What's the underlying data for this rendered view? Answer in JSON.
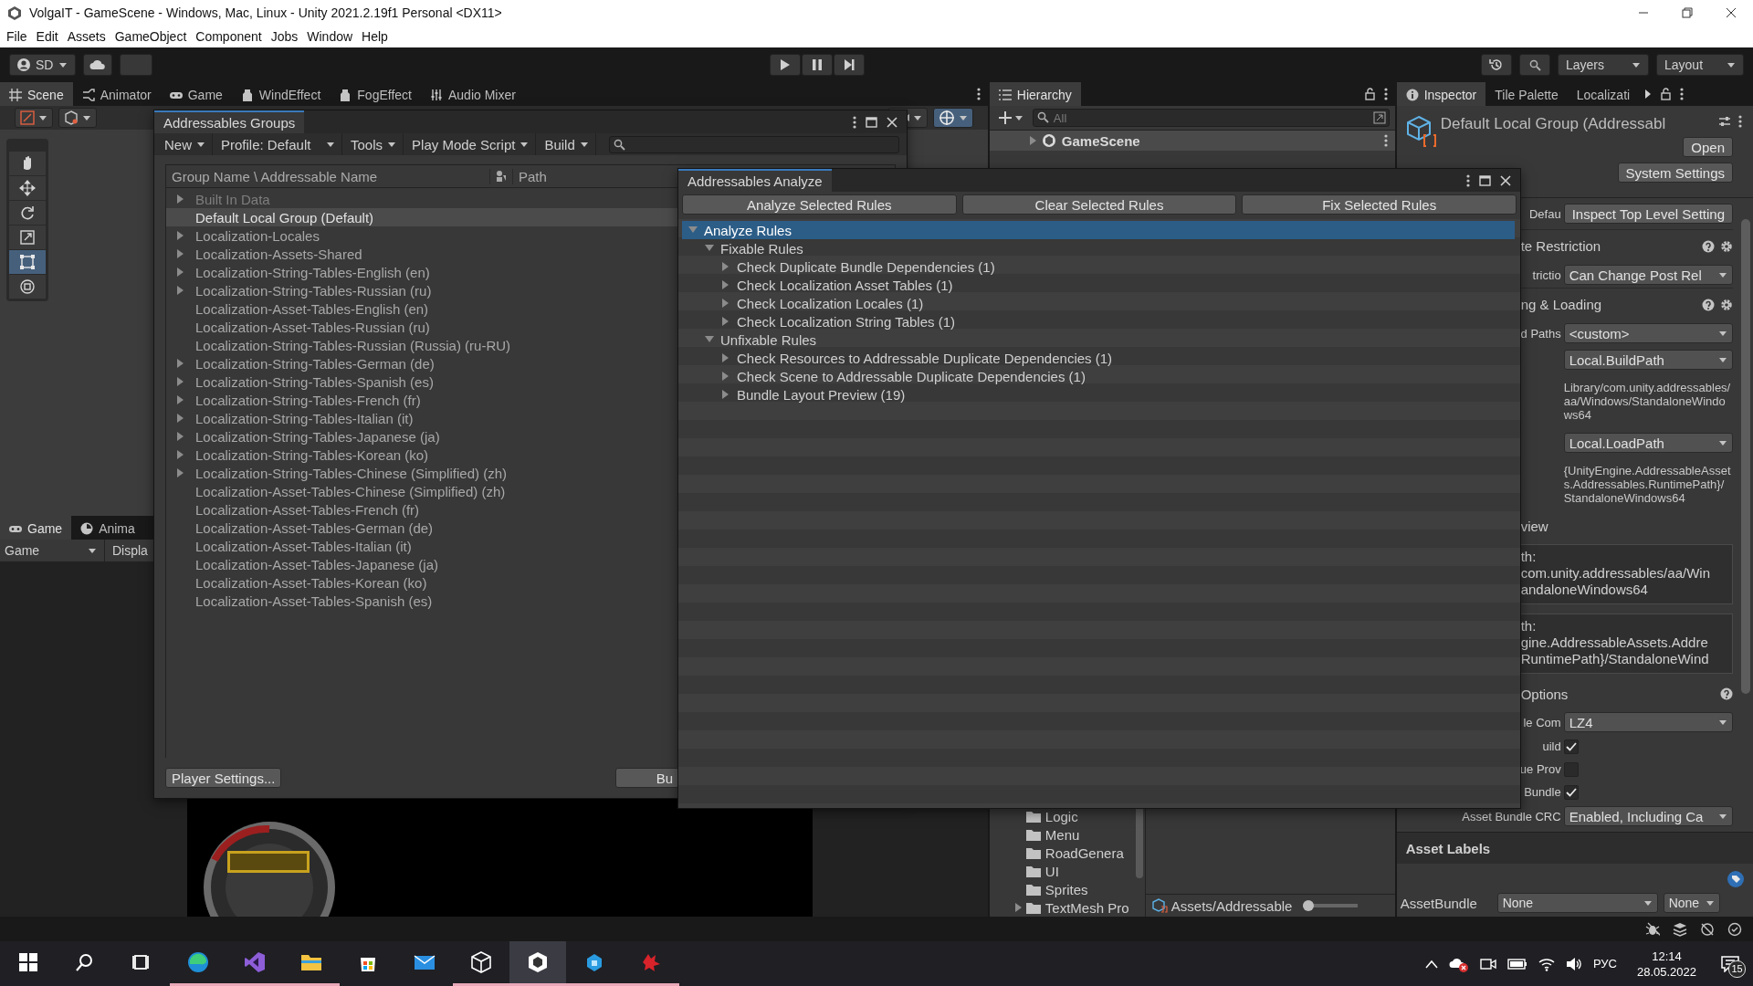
{
  "window": {
    "title": "VolgaIT - GameScene - Windows, Mac, Linux - Unity 2021.2.19f1 Personal <DX11>"
  },
  "menu": [
    "File",
    "Edit",
    "Assets",
    "GameObject",
    "Component",
    "Jobs",
    "Window",
    "Help"
  ],
  "toolbar": {
    "account": "SD",
    "layers": "Layers",
    "layout": "Layout"
  },
  "scene_tabs": [
    {
      "label": "Scene",
      "selected": true
    },
    {
      "label": "Animator",
      "selected": false
    },
    {
      "label": "Game",
      "selected": false
    },
    {
      "label": "WindEffect",
      "selected": false
    },
    {
      "label": "FogEffect",
      "selected": false
    },
    {
      "label": "Audio Mixer",
      "selected": false
    }
  ],
  "tool_palette": [
    {
      "kind": "hand",
      "selected": false
    },
    {
      "kind": "move",
      "selected": false
    },
    {
      "kind": "rotate",
      "selected": false
    },
    {
      "kind": "scale",
      "selected": false
    },
    {
      "kind": "rect",
      "selected": true
    },
    {
      "kind": "transform",
      "selected": false
    }
  ],
  "game_tabs": [
    {
      "label": "Game",
      "selected": true
    },
    {
      "label": "Anima",
      "selected": false
    }
  ],
  "game_toolbar": {
    "display": "Game",
    "option": "Displa"
  },
  "hierarchy": {
    "title": "Hierarchy",
    "search": {
      "placeholder": "All"
    },
    "scene": "GameScene"
  },
  "project": {
    "folders": [
      {
        "label": "Logic",
        "expandable": false
      },
      {
        "label": "Menu",
        "expandable": false
      },
      {
        "label": "RoadGenera",
        "expandable": false
      },
      {
        "label": "UI",
        "expandable": false
      },
      {
        "label": "Sprites",
        "expandable": false
      },
      {
        "label": "TextMesh Pro",
        "expandable": true
      }
    ],
    "path": "Assets/Addressable",
    "zoom_slider": {
      "level": 0
    }
  },
  "inspector": {
    "tabs": [
      {
        "label": "Inspector",
        "selected": true
      },
      {
        "label": "Tile Palette",
        "selected": false
      },
      {
        "label": "Localizati",
        "selected": false
      }
    ],
    "title": "Default Local Group (Addressabl",
    "buttons": [
      "Open",
      "System Settings"
    ],
    "rows": [
      {
        "kind": "button",
        "label": "Defau",
        "value": "Inspect Top Level Setting"
      },
      {
        "kind": "section",
        "label": "te Restriction"
      },
      {
        "kind": "dropdown",
        "label": "trictio",
        "value": "Can Change Post Rel"
      },
      {
        "kind": "section",
        "label": "ng & Loading"
      },
      {
        "kind": "dropdown",
        "label": "d Paths",
        "value": "<custom>"
      },
      {
        "kind": "dropdown",
        "value": "Local.BuildPath"
      },
      {
        "kind": "note",
        "value": "Library/com.unity.addressables/aa/Windows/StandaloneWindows64"
      },
      {
        "kind": "dropdown",
        "value": "Local.LoadPath"
      },
      {
        "kind": "note",
        "value": "{UnityEngine.AddressableAssets.Addressables.RuntimePath}/StandaloneWindows64"
      },
      {
        "kind": "heading",
        "label": "view"
      },
      {
        "kind": "box",
        "lines": [
          "th:",
          "com.unity.addressables/aa/Win",
          "andaloneWindows64"
        ]
      },
      {
        "kind": "box",
        "lines": [
          "th:",
          "gine.AddressableAssets.Addre",
          "RuntimePath}/StandaloneWind"
        ]
      },
      {
        "kind": "subsection",
        "label": "Options"
      },
      {
        "kind": "dropdown",
        "label": "le Com",
        "value": "LZ4"
      },
      {
        "kind": "checkbox",
        "label": "uild",
        "checked": true
      },
      {
        "kind": "checkbox",
        "label": "ue Prov",
        "checked": false
      },
      {
        "kind": "checkbox",
        "label": "Bundle",
        "checked": true
      },
      {
        "kind": "dropdown",
        "label": "Asset Bundle CRC",
        "value": "Enabled, Including Ca"
      }
    ],
    "labels_title": "Asset Labels",
    "asset_bundle": {
      "label": "AssetBundle",
      "name": "None",
      "variant": "None"
    }
  },
  "groups": {
    "title": "Addressables Groups",
    "toolbar": [
      "New",
      "Profile: Default",
      "Tools",
      "Play Mode Script",
      "Build"
    ],
    "columns": [
      "Group Name \\ Addressable Name",
      "Path"
    ],
    "rows": [
      {
        "label": "Built In Data",
        "expandable": true,
        "selected": false,
        "disabled": true
      },
      {
        "label": "Default Local Group (Default)",
        "expandable": false,
        "selected": true,
        "disabled": false
      },
      {
        "label": "Localization-Locales",
        "expandable": true,
        "selected": false,
        "disabled": false
      },
      {
        "label": "Localization-Assets-Shared",
        "expandable": true,
        "selected": false,
        "disabled": false
      },
      {
        "label": "Localization-String-Tables-English (en)",
        "expandable": true,
        "selected": false,
        "disabled": false
      },
      {
        "label": "Localization-String-Tables-Russian (ru)",
        "expandable": true,
        "selected": false,
        "disabled": false
      },
      {
        "label": "Localization-Asset-Tables-English (en)",
        "expandable": false,
        "selected": false,
        "disabled": false
      },
      {
        "label": "Localization-Asset-Tables-Russian (ru)",
        "expandable": false,
        "selected": false,
        "disabled": false
      },
      {
        "label": "Localization-String-Tables-Russian (Russia) (ru-RU)",
        "expandable": false,
        "selected": false,
        "disabled": false
      },
      {
        "label": "Localization-String-Tables-German (de)",
        "expandable": true,
        "selected": false,
        "disabled": false
      },
      {
        "label": "Localization-String-Tables-Spanish (es)",
        "expandable": true,
        "selected": false,
        "disabled": false
      },
      {
        "label": "Localization-String-Tables-French (fr)",
        "expandable": true,
        "selected": false,
        "disabled": false
      },
      {
        "label": "Localization-String-Tables-Italian (it)",
        "expandable": true,
        "selected": false,
        "disabled": false
      },
      {
        "label": "Localization-String-Tables-Japanese (ja)",
        "expandable": true,
        "selected": false,
        "disabled": false
      },
      {
        "label": "Localization-String-Tables-Korean (ko)",
        "expandable": true,
        "selected": false,
        "disabled": false
      },
      {
        "label": "Localization-String-Tables-Chinese (Simplified) (zh)",
        "expandable": true,
        "selected": false,
        "disabled": false
      },
      {
        "label": "Localization-Asset-Tables-Chinese (Simplified) (zh)",
        "expandable": false,
        "selected": false,
        "disabled": false
      },
      {
        "label": "Localization-Asset-Tables-French (fr)",
        "expandable": false,
        "selected": false,
        "disabled": false
      },
      {
        "label": "Localization-Asset-Tables-German (de)",
        "expandable": false,
        "selected": false,
        "disabled": false
      },
      {
        "label": "Localization-Asset-Tables-Italian (it)",
        "expandable": false,
        "selected": false,
        "disabled": false
      },
      {
        "label": "Localization-Asset-Tables-Japanese (ja)",
        "expandable": false,
        "selected": false,
        "disabled": false
      },
      {
        "label": "Localization-Asset-Tables-Korean (ko)",
        "expandable": false,
        "selected": false,
        "disabled": false
      },
      {
        "label": "Localization-Asset-Tables-Spanish (es)",
        "expandable": false,
        "selected": false,
        "disabled": false
      }
    ],
    "footer": [
      "Player Settings...",
      "Bu"
    ]
  },
  "analyze": {
    "title": "Addressables Analyze",
    "buttons": [
      "Analyze Selected Rules",
      "Clear Selected Rules",
      "Fix Selected Rules"
    ],
    "tree": [
      {
        "label": "Analyze Rules",
        "expanded": true,
        "selected": true,
        "children": [
          {
            "label": "Fixable Rules",
            "expanded": true,
            "selected": false,
            "children": [
              {
                "label": "Check Duplicate Bundle Dependencies (1)",
                "expanded": false,
                "selected": false
              },
              {
                "label": "Check Localization Asset Tables (1)",
                "expanded": false,
                "selected": false
              },
              {
                "label": "Check Localization Locales (1)",
                "expanded": false,
                "selected": false
              },
              {
                "label": "Check Localization String Tables (1)",
                "expanded": false,
                "selected": false
              }
            ]
          },
          {
            "label": "Unfixable Rules",
            "expanded": true,
            "selected": false,
            "children": [
              {
                "label": "Check Resources to Addressable Duplicate Dependencies (1)",
                "expanded": false,
                "selected": false
              },
              {
                "label": "Check Scene to Addressable Duplicate Dependencies (1)",
                "expanded": false,
                "selected": false
              },
              {
                "label": "Bundle Layout Preview (19)",
                "expanded": false,
                "selected": false
              }
            ]
          }
        ]
      }
    ]
  },
  "taskbar": {
    "apps": [
      {
        "kind": "start",
        "running": false,
        "selected": false
      },
      {
        "kind": "search",
        "running": false,
        "selected": false
      },
      {
        "kind": "taskview",
        "running": false,
        "selected": false
      },
      {
        "kind": "browser",
        "running": true,
        "selected": false
      },
      {
        "kind": "ide",
        "running": true,
        "selected": false
      },
      {
        "kind": "folder",
        "running": true,
        "selected": false
      },
      {
        "kind": "store",
        "running": false,
        "selected": false
      },
      {
        "kind": "mail",
        "running": false,
        "selected": false
      },
      {
        "kind": "cube-outline",
        "running": true,
        "selected": false
      },
      {
        "kind": "cube",
        "running": true,
        "selected": true
      },
      {
        "kind": "box-app",
        "running": true,
        "selected": false
      },
      {
        "kind": "splat-app",
        "running": true,
        "selected": false
      }
    ],
    "language": "РУС",
    "time": "12:14",
    "date": "28.05.2022",
    "notifications": "15"
  }
}
